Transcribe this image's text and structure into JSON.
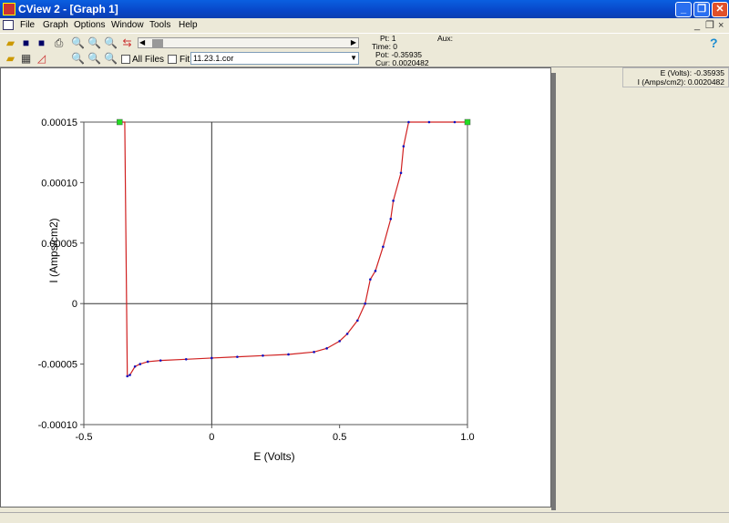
{
  "window": {
    "title": "CView 2 - [Graph 1]",
    "minimize": "_",
    "restore": "❐",
    "close": "✕"
  },
  "menu": [
    "File",
    "Graph",
    "Options",
    "Window",
    "Tools",
    "Help"
  ],
  "mdi_controls": [
    "_",
    "❐",
    "×"
  ],
  "toolbar": {
    "all_files_label": "All Files",
    "fit_label": "Fit",
    "file_value": "11.23.1.cor",
    "help": "?",
    "icons": [
      "open-folder-icon",
      "save-icon",
      "save-as-icon",
      "print-icon",
      "zoom-1-icon",
      "zoom-2-icon",
      "zoom-3-icon",
      "open-list-icon",
      "table-icon",
      "graph-icon",
      "zoom-in-icon",
      "zoom-out-icon",
      "zoom-fit-icon",
      "cursor-icon"
    ]
  },
  "info": {
    "pt": "Pt: 1",
    "time": "Time: 0",
    "pot": "Pot: -0.35935",
    "cur": "Cur: 0.0020482",
    "aux": "Aux:"
  },
  "readout": {
    "e": "E (Volts): -0.35935",
    "i": "I (Amps/cm2): 0.0020482"
  },
  "colors": {
    "line": "#d02020",
    "points": "#1010c0",
    "marker": "#22dd22"
  },
  "chart_data": {
    "type": "line",
    "xlabel": "E (Volts)",
    "ylabel": "I (Amps/cm2)",
    "xlim": [
      -0.5,
      1.0
    ],
    "ylim": [
      -0.0001,
      0.00015
    ],
    "xticks": [
      "-0.5",
      "0",
      "0.5",
      "1.0"
    ],
    "xtick_values": [
      -0.5,
      0,
      0.5,
      1.0
    ],
    "yticks": [
      "0.00015",
      "0.00010",
      "0.00005",
      "0",
      "-0.00005",
      "-0.00010"
    ],
    "ytick_values": [
      0.00015,
      0.0001,
      5e-05,
      0,
      -5e-05,
      -0.0001
    ],
    "grid": "zero-axes",
    "x": [
      -0.36,
      -0.34,
      -0.33,
      -0.32,
      -0.3,
      -0.28,
      -0.25,
      -0.2,
      -0.1,
      0,
      0.1,
      0.2,
      0.3,
      0.4,
      0.45,
      0.5,
      0.53,
      0.57,
      0.6,
      0.62,
      0.64,
      0.67,
      0.7,
      0.71,
      0.74,
      0.75,
      0.77,
      0.85,
      0.95,
      1.0
    ],
    "y": [
      0.00015,
      0.00015,
      -6e-05,
      -5.9e-05,
      -5.2e-05,
      -5e-05,
      -4.8e-05,
      -4.7e-05,
      -4.6e-05,
      -4.5e-05,
      -4.4e-05,
      -4.3e-05,
      -4.2e-05,
      -4e-05,
      -3.7e-05,
      -3.1e-05,
      -2.5e-05,
      -1.4e-05,
      0,
      2e-05,
      2.7e-05,
      4.7e-05,
      7e-05,
      8.5e-05,
      0.000108,
      0.00013,
      0.00015,
      0.00015,
      0.00015,
      0.00015
    ],
    "markers": [
      {
        "x": -0.36,
        "y": 0.00015
      },
      {
        "x": 1.0,
        "y": 0.00015
      }
    ]
  }
}
